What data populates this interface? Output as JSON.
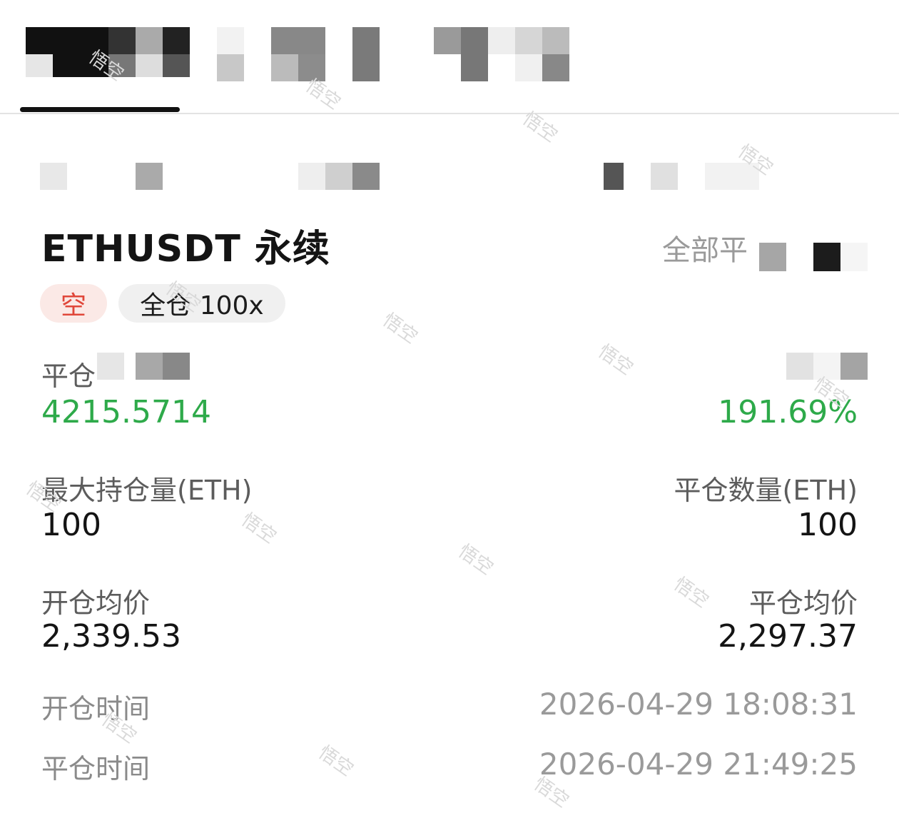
{
  "tabs": {
    "active_index": 0
  },
  "position": {
    "symbol": "ETHUSDT 永续",
    "close_all_label": "全部平",
    "side": "空",
    "margin_mode": "全仓 100x"
  },
  "pnl": {
    "label": "平仓",
    "value": "4215.5714",
    "roi": "191.69%"
  },
  "quantity": {
    "max_label": "最大持仓量(ETH)",
    "max_value": "100",
    "closed_label": "平仓数量(ETH)",
    "closed_value": "100"
  },
  "prices": {
    "open_label": "开仓均价",
    "open_value": "2,339.53",
    "close_label": "平仓均价",
    "close_value": "2,297.37"
  },
  "times": {
    "open_label": "开仓时间",
    "open_value": "2026-04-29 18:08:31",
    "close_label": "平仓时间",
    "close_value": "2026-04-29 21:49:25"
  },
  "watermark": {
    "text": "悟空"
  },
  "colors": {
    "profit_green": "#2eaa4a",
    "short_red": "#e0473a",
    "short_bg": "#fbe9e6",
    "badge_bg": "#f0f0f0",
    "muted_text": "#9a9a9a"
  }
}
